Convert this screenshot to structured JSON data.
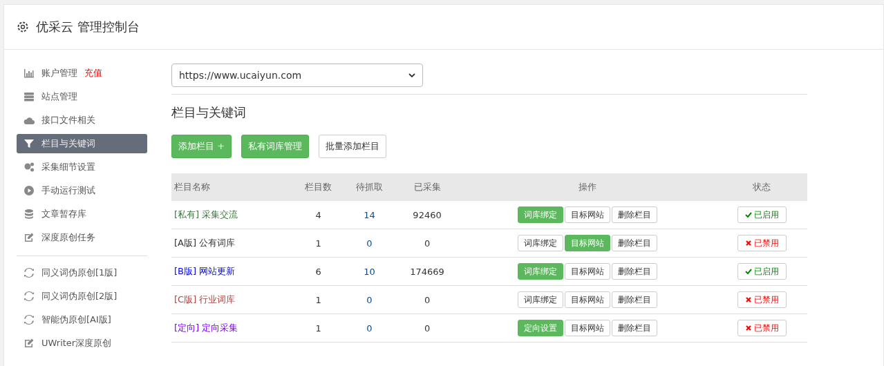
{
  "header": {
    "title": "优采云 管理控制台"
  },
  "sidebar": {
    "items": [
      {
        "kind": "item",
        "label": "账户管理",
        "badge": "充值",
        "selected": false
      },
      {
        "kind": "item",
        "label": "站点管理",
        "selected": false
      },
      {
        "kind": "item",
        "label": "接口文件相关",
        "selected": false
      },
      {
        "kind": "item",
        "label": "栏目与关键词",
        "selected": true
      },
      {
        "kind": "item",
        "label": "采集细节设置",
        "selected": false
      },
      {
        "kind": "item",
        "label": "手动运行测试",
        "selected": false
      },
      {
        "kind": "item",
        "label": "文章暂存库",
        "selected": false
      },
      {
        "kind": "item",
        "label": "深度原创任务",
        "selected": false
      },
      {
        "kind": "divider"
      },
      {
        "kind": "item",
        "label": "同义词伪原创[1版]",
        "selected": false
      },
      {
        "kind": "item",
        "label": "同义词伪原创[2版]",
        "selected": false
      },
      {
        "kind": "item",
        "label": "智能伪原创[AI版]",
        "selected": false
      },
      {
        "kind": "item",
        "label": "UWriter深度原创",
        "selected": false
      }
    ]
  },
  "site_select": {
    "value": "https://www.ucaiyun.com"
  },
  "section_title": "栏目与关键词",
  "toolbar": [
    {
      "label": "添加栏目 +",
      "primary": true
    },
    {
      "label": "私有词库管理",
      "primary": true
    },
    {
      "label": "批量添加栏目",
      "primary": false
    }
  ],
  "table": {
    "columns": [
      "栏目名称",
      "栏目数",
      "待抓取",
      "已采集",
      "操作",
      "状态"
    ],
    "rows": [
      {
        "tag": "[私有]",
        "name": "采集交流",
        "color": "#3c763d",
        "c1": "4",
        "c2": "14",
        "c3": "92460",
        "actions": [
          {
            "label": "词库绑定",
            "primary": true
          },
          {
            "label": "目标网站",
            "primary": false
          },
          {
            "label": "删除栏目",
            "primary": false
          }
        ],
        "enabled": true,
        "status": "已启用"
      },
      {
        "tag": "[A版]",
        "name": "公有词库",
        "color": "#333333",
        "c1": "1",
        "c2": "0",
        "c3": "0",
        "actions": [
          {
            "label": "词库绑定",
            "primary": false
          },
          {
            "label": "目标网站",
            "primary": true
          },
          {
            "label": "删除栏目",
            "primary": false
          }
        ],
        "enabled": false,
        "status": "已禁用"
      },
      {
        "tag": "[B版]",
        "name": "网站更新",
        "color": "#0000ff",
        "c1": "6",
        "c2": "10",
        "c3": "174669",
        "actions": [
          {
            "label": "词库绑定",
            "primary": true
          },
          {
            "label": "目标网站",
            "primary": false
          },
          {
            "label": "删除栏目",
            "primary": false
          }
        ],
        "enabled": true,
        "status": "已启用"
      },
      {
        "tag": "[C版]",
        "name": "行业词库",
        "color": "#a94442",
        "c1": "1",
        "c2": "0",
        "c3": "0",
        "actions": [
          {
            "label": "词库绑定",
            "primary": false
          },
          {
            "label": "目标网站",
            "primary": false
          },
          {
            "label": "删除栏目",
            "primary": false
          }
        ],
        "enabled": false,
        "status": "已禁用"
      },
      {
        "tag": "[定向]",
        "name": "定向采集",
        "color": "#8000ff",
        "c1": "1",
        "c2": "0",
        "c3": "0",
        "actions": [
          {
            "label": "定向设置",
            "primary": true
          },
          {
            "label": "目标网站",
            "primary": false
          },
          {
            "label": "删除栏目",
            "primary": false
          }
        ],
        "enabled": false,
        "status": "已禁用"
      }
    ]
  }
}
